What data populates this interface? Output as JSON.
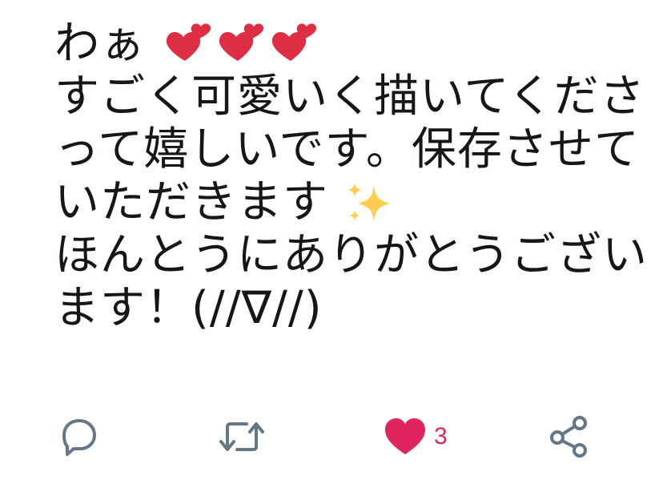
{
  "tweet": {
    "line1_text": "わぁ",
    "line1_emoji": "two-hearts-icon",
    "line2": "すごく可愛いく描いてくださ",
    "line3": "って嬉しいです。保存させて",
    "line4_text": "いただきます",
    "line4_emoji": "sparkles-icon",
    "line5": "ほんとうにありがとうござい",
    "line6": "ます！(//∇//)"
  },
  "actions": {
    "reply_icon": "reply-icon",
    "retweet_icon": "retweet-icon",
    "like_icon": "heart-icon",
    "like_count": "3",
    "share_icon": "share-icon"
  },
  "colors": {
    "text": "#14171a",
    "icon": "#657786",
    "like": "#e0245e",
    "heart_emoji": "#dd2e44",
    "sparkle": "#ffcc4d"
  }
}
